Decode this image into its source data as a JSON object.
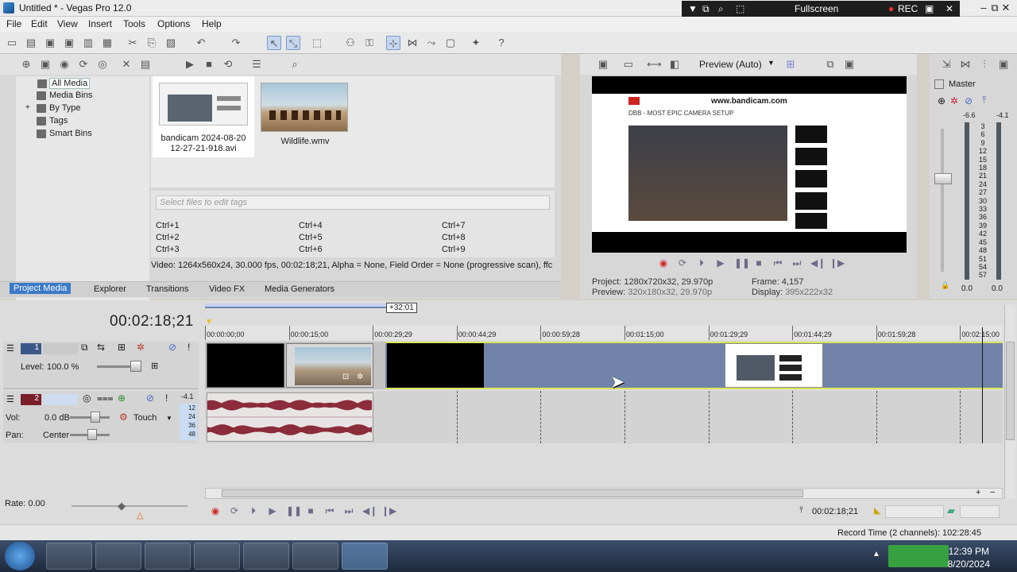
{
  "window": {
    "title": "Untitled * - Vegas Pro 12.0",
    "minimize": "–",
    "restore": "⧉",
    "close": "✕"
  },
  "bandicam": {
    "mode": "Fullscreen",
    "rec": "REC"
  },
  "menu": [
    "File",
    "Edit",
    "View",
    "Insert",
    "Tools",
    "Options",
    "Help"
  ],
  "media": {
    "tree": [
      "All Media",
      "Media Bins",
      "By Type",
      "Tags",
      "Smart Bins"
    ],
    "thumbs": [
      {
        "name": "bandicam 2024-08-20\n12-27-21-918.avi"
      },
      {
        "name": "Wildlife.wmv"
      }
    ],
    "tag_placeholder": "Select files to edit tags",
    "shortcuts": [
      "Ctrl+1",
      "Ctrl+2",
      "Ctrl+3",
      "Ctrl+4",
      "Ctrl+5",
      "Ctrl+6",
      "Ctrl+7",
      "Ctrl+8",
      "Ctrl+9"
    ],
    "info": "Video: 1264x560x24, 30.000 fps, 00:02:18;21, Alpha = None, Field Order = None (progressive scan), ffc",
    "tabs": [
      "Project Media",
      "Explorer",
      "Transitions",
      "Video FX",
      "Media Generators"
    ]
  },
  "preview": {
    "mode": "Preview (Auto)",
    "project_label": "Project:",
    "project_value": "1280x720x32, 29.970p",
    "preview_label": "Preview:",
    "preview_value": "320x180x32, 29.970p",
    "frame_label": "Frame:",
    "frame_value": "4,157",
    "display_label": "Display:",
    "display_value": "395x222x32",
    "screen_site": "www.bandicam.com",
    "screen_headline": "DBB - MOST EPIC CAMERA SETUP"
  },
  "master": {
    "title": "Master",
    "left_peak": "-6.6",
    "right_peak": "-4.1",
    "scale": [
      "3",
      "6",
      "9",
      "12",
      "15",
      "18",
      "21",
      "24",
      "27",
      "30",
      "33",
      "36",
      "39",
      "42",
      "45",
      "48",
      "51",
      "54",
      "57"
    ],
    "left_level": "0.0",
    "right_level": "0.0"
  },
  "timeline": {
    "current_time": "00:02:18;21",
    "loop_length": "+32:01",
    "ruler": [
      "00:00:00;00",
      "00:00:15;00",
      "00:00:29;29",
      "00:00:44;29",
      "00:00:59;28",
      "00:01:15;00",
      "00:01:29;29",
      "00:01:44;29",
      "00:01:59;28",
      "00:02:15;00"
    ],
    "video_track": {
      "number": "1",
      "level_label": "Level:",
      "level": "100.0 %"
    },
    "audio_track": {
      "number": "2",
      "peak": "-4.1",
      "vol_label": "Vol:",
      "vol": "0.0 dB",
      "pan_label": "Pan:",
      "pan": "Center",
      "automation": "Touch",
      "meter": [
        "12",
        "24",
        "36",
        "48"
      ]
    },
    "rate": "Rate: 0.00",
    "cursor_time": "00:02:18;21"
  },
  "status": {
    "record_time": "Record Time (2 channels): 102:28:45"
  },
  "taskbar": {
    "time": "12:39 PM",
    "date": "8/20/2024"
  },
  "colors": {
    "accent": "#3b7ac8",
    "loop_region": "#6d7fa6",
    "waveform": "#8b2c3a",
    "record": "#d22a2a"
  }
}
